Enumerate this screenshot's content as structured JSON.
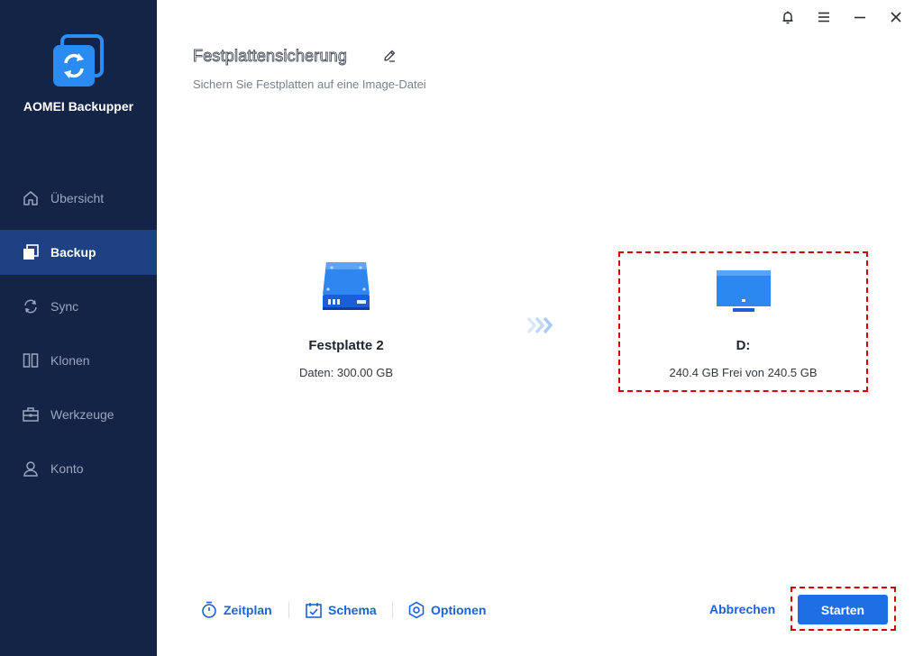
{
  "app": {
    "name": "AOMEI Backupper"
  },
  "sidebar": {
    "items": [
      {
        "label": "Übersicht",
        "icon": "home-icon",
        "active": false
      },
      {
        "label": "Backup",
        "icon": "backup-icon",
        "active": true
      },
      {
        "label": "Sync",
        "icon": "sync-icon",
        "active": false
      },
      {
        "label": "Klonen",
        "icon": "clone-icon",
        "active": false
      },
      {
        "label": "Werkzeuge",
        "icon": "toolbox-icon",
        "active": false
      },
      {
        "label": "Konto",
        "icon": "user-icon",
        "active": false
      }
    ]
  },
  "window_controls": [
    "bell-icon",
    "menu-icon",
    "minimize-icon",
    "close-icon"
  ],
  "header": {
    "title": "Festplattensicherung",
    "subtitle": "Sichern Sie Festplatten auf eine Image-Datei"
  },
  "source": {
    "name": "Festplatte 2",
    "info": "Daten: 300.00 GB",
    "icon": "hard-drive-icon"
  },
  "destination": {
    "name": "D:",
    "info": "240.4 GB Frei von 240.5 GB",
    "icon": "monitor-icon"
  },
  "footer": {
    "schedule_label": "Zeitplan",
    "scheme_label": "Schema",
    "options_label": "Optionen",
    "cancel_label": "Abbrechen",
    "start_label": "Starten"
  },
  "colors": {
    "sidebar_bg": "#142447",
    "sidebar_active": "#1d4183",
    "accent": "#1e6fe6",
    "highlight": "#d40000"
  }
}
